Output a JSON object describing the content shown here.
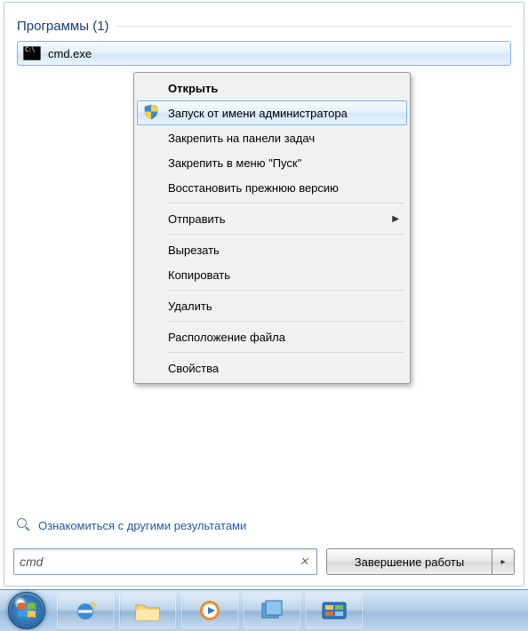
{
  "section": {
    "title": "Программы (1)"
  },
  "result": {
    "label": "cmd.exe"
  },
  "context_menu": {
    "open": "Открыть",
    "run_as_admin": "Запуск от имени администратора",
    "pin_taskbar": "Закрепить на панели задач",
    "pin_start": "Закрепить в меню \"Пуск\"",
    "restore_prev": "Восстановить прежнюю версию",
    "send_to": "Отправить",
    "cut": "Вырезать",
    "copy": "Копировать",
    "delete": "Удалить",
    "open_location": "Расположение файла",
    "properties": "Свойства"
  },
  "more_results": "Ознакомиться с другими результатами",
  "search": {
    "value": "cmd"
  },
  "shutdown": {
    "label": "Завершение работы"
  }
}
